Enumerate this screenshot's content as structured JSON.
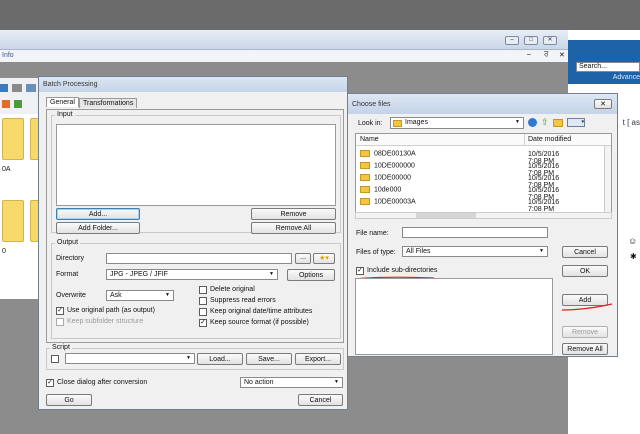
{
  "background_window": {
    "title": "Info",
    "controls": [
      "–",
      "□",
      "✕"
    ],
    "sub_controls": [
      "–",
      "ਰ",
      "✕"
    ],
    "folder_label_1": "0A",
    "folder_label_2": "0"
  },
  "browser": {
    "search_placeholder": "Search...",
    "advanced_label": "Advance",
    "bracket_text": "t [ as"
  },
  "batch": {
    "title": "Batch Processing",
    "tabs": [
      "General",
      "Transformations"
    ],
    "input_group": "Input",
    "add_label": "Add...",
    "remove_label": "Remove",
    "add_folder_label": "Add Folder...",
    "remove_all_label": "Remove All",
    "output_group": "Output",
    "directory_label": "Directory",
    "directory_value": "",
    "browse_label": "...",
    "format_label": "Format",
    "format_value": "JPG - JPEG / JFIF",
    "options_label": "Options",
    "overwrite_label": "Overwrite",
    "overwrite_value": "Ask",
    "checks": {
      "use_original_path": "Use original path (as output)",
      "keep_subfolder": "Keep subfolder structure",
      "delete_original": "Delete original",
      "suppress_errors": "Suppress read errors",
      "keep_date": "Keep original date/time attributes",
      "keep_format": "Keep source format (if possible)"
    },
    "script_group": "Script",
    "script_value": "",
    "load_label": "Load...",
    "save_label": "Save...",
    "export_label": "Export...",
    "close_dialog_label": "Close dialog after conversion",
    "action_value": "No action",
    "go_label": "Go",
    "cancel_label": "Cancel"
  },
  "choose": {
    "title": "Choose files",
    "look_in_label": "Look in:",
    "look_in_value": "Images",
    "col_name": "Name",
    "col_date": "Date modified",
    "files": [
      {
        "name": "08DE00130A",
        "date": "10/5/2016 7:08 PM"
      },
      {
        "name": "10DE000000",
        "date": "10/5/2016 7:08 PM"
      },
      {
        "name": "10DE00000",
        "date": "10/5/2016 7:08 PM"
      },
      {
        "name": "10de000",
        "date": "10/5/2016 7:08 PM"
      },
      {
        "name": "10DE00003A",
        "date": "10/5/2016 7:08 PM"
      }
    ],
    "file_name_label": "File name:",
    "file_name_value": "",
    "files_of_type_label": "Files of type:",
    "files_of_type_value": "All Files",
    "include_sub_label": "Include sub-directories",
    "cancel_label": "Cancel",
    "ok_label": "OK",
    "add_label": "Add",
    "remove_label": "Remove",
    "remove_all_label": "Remove All",
    "annotation_color": "#e0201a"
  }
}
